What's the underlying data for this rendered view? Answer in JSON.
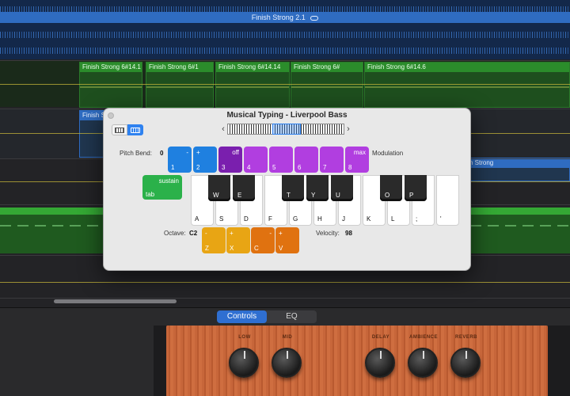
{
  "tracks": {
    "audio_region_title": "Finish Strong 2.1",
    "midi_regions": [
      {
        "title": "Finish Strong 6#14.1"
      },
      {
        "title": "Finish Strong 6#1"
      },
      {
        "title": "Finish Strong 6#14.14"
      },
      {
        "title": "Finish Strong 6#"
      },
      {
        "title": "Finish Strong 6#14.6"
      }
    ],
    "blue_region_left_title": "Finish S",
    "blue_region_right_title": "sh Strong"
  },
  "musical_typing": {
    "title": "Musical Typing - Liverpool Bass",
    "pitch_bend_label": "Pitch Bend:",
    "pitch_bend_value": "0",
    "modulation_label": "Modulation",
    "octave_label": "Octave:",
    "octave_value": "C2",
    "velocity_label": "Velocity:",
    "velocity_value": "98",
    "top_keys": [
      {
        "top": "-",
        "bottom": "1"
      },
      {
        "top": "+",
        "bottom": "2"
      },
      {
        "top": "off",
        "bottom": "3"
      },
      {
        "top": "",
        "bottom": "4"
      },
      {
        "top": "",
        "bottom": "5"
      },
      {
        "top": "",
        "bottom": "6"
      },
      {
        "top": "",
        "bottom": "7"
      },
      {
        "top": "max",
        "bottom": "8"
      }
    ],
    "sustain_top": "sustain",
    "sustain_bottom": "tab",
    "white_keys": [
      "A",
      "S",
      "D",
      "F",
      "G",
      "H",
      "J",
      "K",
      "L",
      ";",
      "'"
    ],
    "black_keys": [
      "W",
      "E",
      "T",
      "Y",
      "U",
      "O",
      "P"
    ],
    "octave_keys": [
      {
        "top": "-",
        "bottom": "Z"
      },
      {
        "top": "+",
        "bottom": "X"
      }
    ],
    "velocity_keys": [
      {
        "top": "-",
        "bottom": "C"
      },
      {
        "top": "+",
        "bottom": "V"
      }
    ]
  },
  "bottom_panel": {
    "tabs": [
      "Controls",
      "EQ"
    ],
    "active_tab": "Controls",
    "knobs": [
      {
        "label": "LOW"
      },
      {
        "label": "MID"
      },
      {
        "label": "DELAY"
      },
      {
        "label": "AMBIENCE"
      },
      {
        "label": "REVERB"
      }
    ]
  },
  "colors": {
    "accent": "#2f82f0",
    "pitch_bend_keys": "#1f80e0",
    "modulation_keys": "#b13ee0",
    "octave_keys": "#e8a514",
    "velocity_keys": "#e07210",
    "sustain_key": "#2bb14a"
  },
  "icons": {
    "view_piano": "piano-keyboard-icon",
    "view_keyboard": "computer-keyboard-icon",
    "close": "close-dot-icon",
    "range_prev": "chevron-left-icon",
    "range_next": "chevron-right-icon"
  }
}
